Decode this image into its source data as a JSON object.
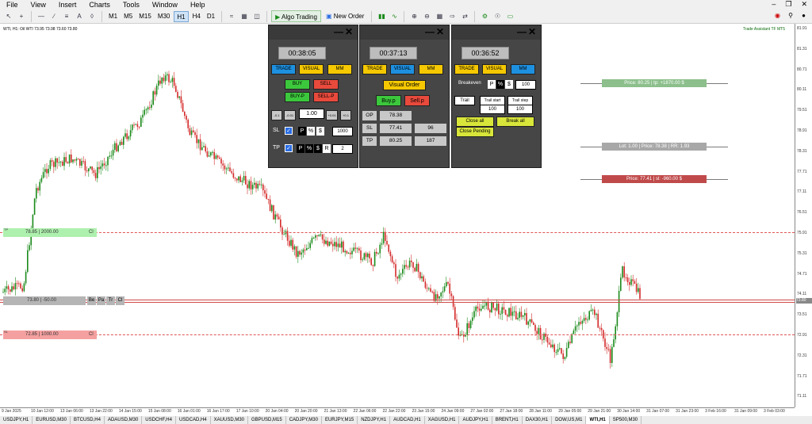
{
  "menu": [
    "File",
    "View",
    "Insert",
    "Charts",
    "Tools",
    "Window",
    "Help"
  ],
  "toolbar": {
    "timeframes": [
      "M1",
      "M5",
      "M15",
      "M30",
      "H1",
      "H4",
      "D1"
    ],
    "active_tf": "H1",
    "algo_trading": "Algo Trading",
    "new_order": "New Order"
  },
  "chart": {
    "title": "WTI, H1:  Oil WTI  73.95 73.98 73.60 73.80",
    "assistant_label": "Trade Assistant TF MT5",
    "price_ticks": [
      "81.91",
      "81.31",
      "80.71",
      "80.11",
      "79.51",
      "78.91",
      "78.31",
      "77.71",
      "77.11",
      "76.51",
      "75.91",
      "75.31",
      "74.71",
      "74.11",
      "73.51",
      "72.91",
      "72.31",
      "71.71",
      "71.11"
    ],
    "current_price": "73.80",
    "time_labels": [
      "9 Jan 2025",
      "10 Jan 12:00",
      "13 Jan 06:00",
      "13 Jan 22:00",
      "14 Jan 15:00",
      "15 Jan 08:00",
      "16 Jan 01:00",
      "16 Jan 17:00",
      "17 Jan 10:00",
      "20 Jan 04:00",
      "20 Jan 20:00",
      "21 Jan 13:00",
      "22 Jan 06:00",
      "22 Jan 22:00",
      "23 Jan 15:00",
      "24 Jan 09:00",
      "27 Jan 02:00",
      "27 Jan 18:00",
      "28 Jan 11:00",
      "29 Jan 05:00",
      "29 Jan 21:00",
      "30 Jan 14:00",
      "31 Jan 07:00",
      "31 Jan 23:00",
      "3 Feb 16:00",
      "31 Jan 09:00",
      "3 Feb 03:00"
    ]
  },
  "lines": {
    "tp": {
      "prefix": "TP",
      "label": "78.85 | 2000.00",
      "cl": "Cl",
      "color": "#e05555"
    },
    "entry": {
      "prefix": "BUY 1 at 73.85",
      "label": "73.80 | -50.00",
      "buttons": [
        "Be",
        "Pa",
        "Tr",
        "Cl"
      ],
      "color": "#888888"
    },
    "sl": {
      "prefix": "SL",
      "label": "72.85 | 1000.00",
      "cl": "Cl",
      "color": "#e05555"
    }
  },
  "right_labels": {
    "price_tp": "Price: 80.25 | tp: +1870.00 $",
    "lot": "Lot: 1.00 | Price: 78.38 | RR: 1.93",
    "price_sl": "Price: 77.41 | sl: -960.00 $"
  },
  "panel1": {
    "timer": "00:38:05",
    "tabs": [
      "TRADE",
      "VISUAL",
      "MM"
    ],
    "buy": "BUY",
    "sell": "SELL",
    "buy_p": "BUY-P",
    "sell_p": "SELL-P",
    "lot_steps": [
      "-0.1",
      "-0.01",
      "+0.01",
      "+0.1"
    ],
    "lot": "1.00",
    "sl_label": "SL",
    "tp_label": "TP",
    "p": "P",
    "pct": "%",
    "usd": "$",
    "r": "R",
    "sl_value": "1000",
    "tp_value": "2"
  },
  "panel2": {
    "timer": "00:37:13",
    "tabs": [
      "TRADE",
      "VISUAL",
      "MM"
    ],
    "visual_order": "Visual Order",
    "buy_p": "Buy.p",
    "sell_p": "Sell.p",
    "op_label": "OP",
    "op_value": "78.38",
    "sl_label": "SL",
    "sl_value": "77.41",
    "sl_points": "96",
    "tp_label": "TP",
    "tp_value": "80.25",
    "tp_points": "187"
  },
  "panel3": {
    "timer": "00:36:52",
    "tabs": [
      "TRADE",
      "VISUAL",
      "MM"
    ],
    "breakeven": "Breakeven",
    "p": "P",
    "pct": "%",
    "usd": "$",
    "be_value": "100",
    "trail": "Trail",
    "trail_start": "Trail start",
    "trail_step": "Trail step",
    "trail_start_value": "100",
    "trail_step_value": "100",
    "close_all": "Close all",
    "break_all": "Break all",
    "close_pending": "Close Pending"
  },
  "symbol_tabs": [
    "USDJPY,H1",
    "EURUSD,M30",
    "BTCUSD,H4",
    "ADAUSD,M30",
    "USDCHF,H4",
    "USDCAD,H4",
    "XAUUSD,M30",
    "GBPUSD,M15",
    "CADJPY,M30",
    "EURJPY,M15",
    "NZDJPY,H1",
    "AUDCAD,H1",
    "XAGUSD,H1",
    "AUDJPY,H1",
    "BRENT,H1",
    "DAX30,H1",
    "DOW,US,M1",
    "WTI,H1",
    "SP500,M30"
  ],
  "active_symbol": "WTI,H1",
  "colors": {
    "buy": "#3cc83c",
    "sell": "#e84a3c",
    "tab_blue": "#1e90e0",
    "tab_yellow": "#f5c800",
    "tp_line": "#e05555"
  }
}
